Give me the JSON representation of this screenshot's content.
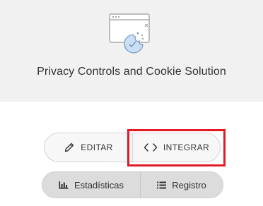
{
  "header": {
    "title": "Privacy Controls and Cookie Solution",
    "icon": "browser-window-cookie-icon",
    "accent": "#c8dff5"
  },
  "actions": {
    "edit_label": "EDITAR",
    "integrate_label": "INTEGRAR"
  },
  "views": {
    "stats_label": "Estadísticas",
    "log_label": "Registro"
  },
  "highlight_color": "#e01b24"
}
